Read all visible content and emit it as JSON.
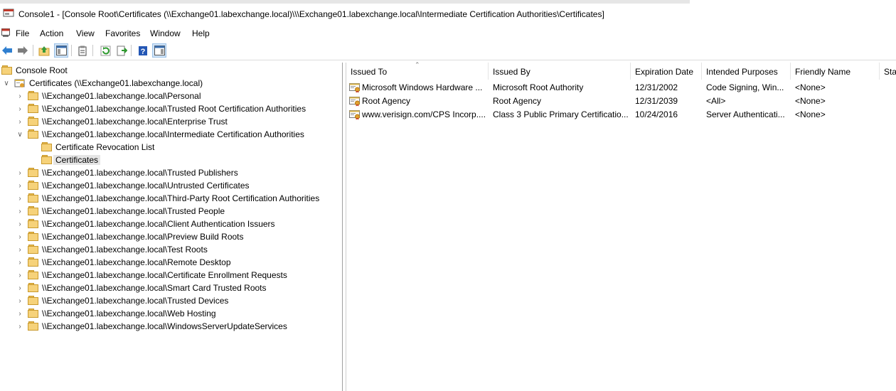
{
  "window": {
    "title": "Console1 - [Console Root\\Certificates (\\\\Exchange01.labexchange.local)\\\\\\Exchange01.labexchange.local\\Intermediate Certification Authorities\\Certificates]"
  },
  "menu": {
    "items": [
      "File",
      "Action",
      "View",
      "Favorites",
      "Window",
      "Help"
    ]
  },
  "toolbar": {
    "buttons": [
      "back-icon",
      "forward-icon",
      "up-folder-icon",
      "show-hide-tree-icon",
      "properties-icon",
      "refresh-icon",
      "export-list-icon",
      "help-icon",
      "show-hide-action-pane-icon"
    ]
  },
  "tree": {
    "root": "Console Root",
    "snapin": "Certificates (\\\\Exchange01.labexchange.local)",
    "stores": [
      "\\\\Exchange01.labexchange.local\\Personal",
      "\\\\Exchange01.labexchange.local\\Trusted Root Certification Authorities",
      "\\\\Exchange01.labexchange.local\\Enterprise Trust",
      "\\\\Exchange01.labexchange.local\\Intermediate Certification Authorities",
      "\\\\Exchange01.labexchange.local\\Trusted Publishers",
      "\\\\Exchange01.labexchange.local\\Untrusted Certificates",
      "\\\\Exchange01.labexchange.local\\Third-Party Root Certification Authorities",
      "\\\\Exchange01.labexchange.local\\Trusted People",
      "\\\\Exchange01.labexchange.local\\Client Authentication Issuers",
      "\\\\Exchange01.labexchange.local\\Preview Build Roots",
      "\\\\Exchange01.labexchange.local\\Test Roots",
      "\\\\Exchange01.labexchange.local\\Remote Desktop",
      "\\\\Exchange01.labexchange.local\\Certificate Enrollment Requests",
      "\\\\Exchange01.labexchange.local\\Smart Card Trusted Roots",
      "\\\\Exchange01.labexchange.local\\Trusted Devices",
      "\\\\Exchange01.labexchange.local\\Web Hosting",
      "\\\\Exchange01.labexchange.local\\WindowsServerUpdateServices"
    ],
    "intermediate_children": [
      "Certificate Revocation List",
      "Certificates"
    ],
    "selected": "Certificates"
  },
  "list": {
    "columns": [
      "Issued To",
      "Issued By",
      "Expiration Date",
      "Intended Purposes",
      "Friendly Name",
      "Sta"
    ],
    "rows": [
      [
        "Microsoft Windows Hardware ...",
        "Microsoft Root Authority",
        "12/31/2002",
        "Code Signing, Win...",
        "<None>"
      ],
      [
        "Root Agency",
        "Root Agency",
        "12/31/2039",
        "<All>",
        "<None>"
      ],
      [
        "www.verisign.com/CPS Incorp....",
        "Class 3 Public Primary Certificatio...",
        "10/24/2016",
        "Server Authenticati...",
        "<None>"
      ]
    ]
  },
  "colors": {
    "selection": "#e5e5e5",
    "folder": "#f6d27a",
    "toolbar_pressed": "#cfe3f7"
  }
}
